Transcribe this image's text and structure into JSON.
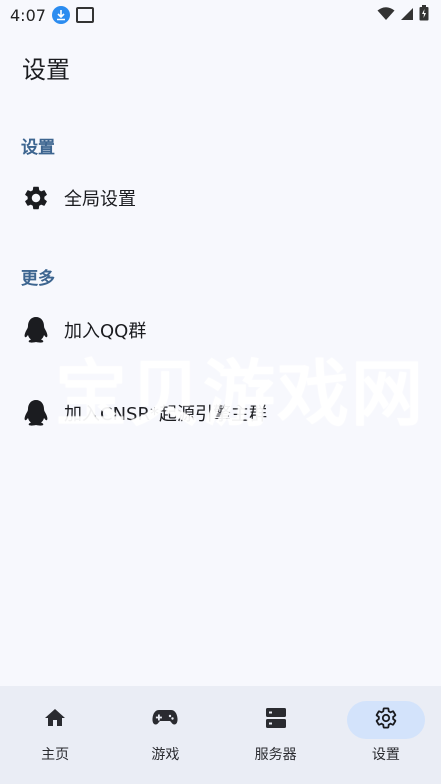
{
  "status_bar": {
    "time": "4:07"
  },
  "page": {
    "title": "设置"
  },
  "sections": [
    {
      "header": "设置",
      "items": [
        {
          "label": "全局设置",
          "icon": "gear-icon"
        }
      ]
    },
    {
      "header": "更多",
      "items": [
        {
          "label": "加入QQ群",
          "icon": "qq-penguin-icon"
        },
        {
          "label": "加入CNSR*起源引擎主群",
          "icon": "qq-penguin-icon"
        }
      ]
    }
  ],
  "watermark": {
    "text": "宝贝游戏网"
  },
  "bottom_nav": {
    "items": [
      {
        "label": "主页",
        "icon": "home-icon"
      },
      {
        "label": "游戏",
        "icon": "gamepad-icon"
      },
      {
        "label": "服务器",
        "icon": "server-icon"
      },
      {
        "label": "设置",
        "icon": "gear-icon"
      }
    ],
    "active_index": 3
  },
  "colors": {
    "accent": "#3d6590",
    "nav_active_pill": "#d3e3fb",
    "background": "#f7f8fd",
    "nav_background": "#eaedf5"
  }
}
